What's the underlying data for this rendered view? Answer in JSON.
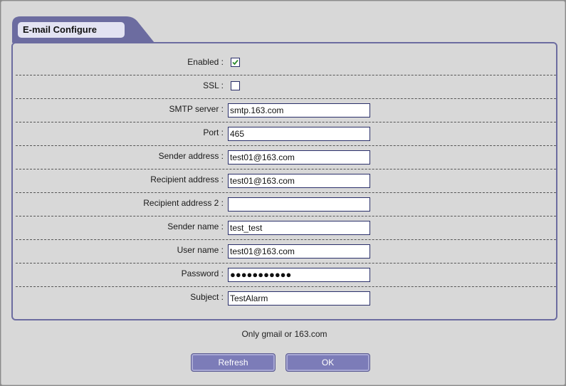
{
  "header": {
    "title": "E-mail Configure"
  },
  "form": {
    "enabled": {
      "label": "Enabled :",
      "checked": true
    },
    "ssl": {
      "label": "SSL :",
      "checked": false
    },
    "smtp_server": {
      "label": "SMTP server :",
      "value": "smtp.163.com"
    },
    "port": {
      "label": "Port :",
      "value": "465"
    },
    "sender_address": {
      "label": "Sender address :",
      "value": "test01@163.com"
    },
    "recipient_address": {
      "label": "Recipient address :",
      "value": "test01@163.com"
    },
    "recipient_address_2": {
      "label": "Recipient address 2 :",
      "value": ""
    },
    "sender_name": {
      "label": "Sender name :",
      "value": "test_test"
    },
    "user_name": {
      "label": "User name :",
      "value": "test01@163.com"
    },
    "password": {
      "label": "Password :",
      "value": "●●●●●●●●●●●"
    },
    "subject": {
      "label": "Subject :",
      "value": "TestAlarm"
    }
  },
  "note": "Only gmail or 163.com",
  "buttons": {
    "refresh_label": "Refresh",
    "ok_label": "OK"
  },
  "colors": {
    "accent": "#7c7cb8",
    "border": "#6c6ca0",
    "check": "#2e8b2e"
  }
}
